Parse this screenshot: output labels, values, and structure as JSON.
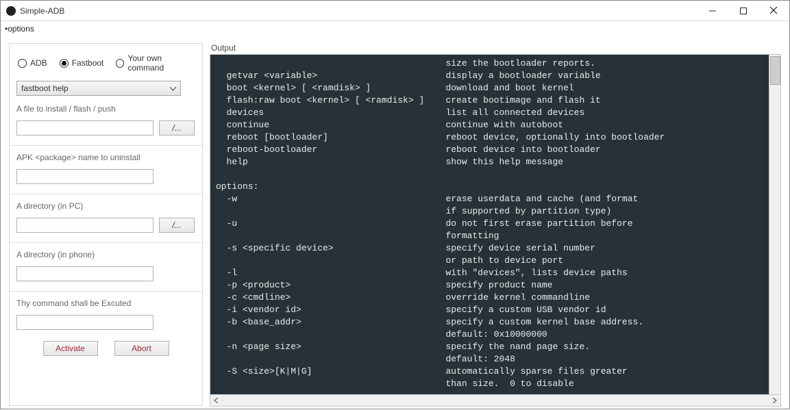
{
  "window": {
    "title": "Simple-ADB"
  },
  "menu": {
    "options": "•options"
  },
  "mode": {
    "adb": "ADB",
    "fastboot": "Fastboot",
    "custom": "Your own command"
  },
  "dropdown": {
    "selected": "fastboot help"
  },
  "labels": {
    "file_flash": "A file to install / flash / push",
    "apk_uninstall": "APK <package> name to uninstall",
    "dir_pc": "A directory (in PC)",
    "dir_phone": "A directory (in phone)",
    "command": "Thy command shall be Excuted",
    "browse": "/...",
    "activate": "Activate",
    "abort": "Abort",
    "output": "Output"
  },
  "terminal_text": "                                           size the bootloader reports.\n  getvar <variable>                        display a bootloader variable\n  boot <kernel> [ <ramdisk> ]              download and boot kernel\n  flash:raw boot <kernel> [ <ramdisk> ]    create bootimage and flash it\n  devices                                  list all connected devices\n  continue                                 continue with autoboot\n  reboot [bootloader]                      reboot device, optionally into bootloader\n  reboot-bootloader                        reboot device into bootloader\n  help                                     show this help message\n\noptions:\n  -w                                       erase userdata and cache (and format\n                                           if supported by partition type)\n  -u                                       do not first erase partition before\n                                           formatting\n  -s <specific device>                     specify device serial number\n                                           or path to device port\n  -l                                       with \"devices\", lists device paths\n  -p <product>                             specify product name\n  -c <cmdline>                             override kernel commandline\n  -i <vendor id>                           specify a custom USB vendor id\n  -b <base_addr>                           specify a custom kernel base address.\n                                           default: 0x10000000\n  -n <page size>                           specify the nand page size.\n                                           default: 2048\n  -S <size>[K|M|G]                         automatically sparse files greater\n                                           than size.  0 to disable"
}
